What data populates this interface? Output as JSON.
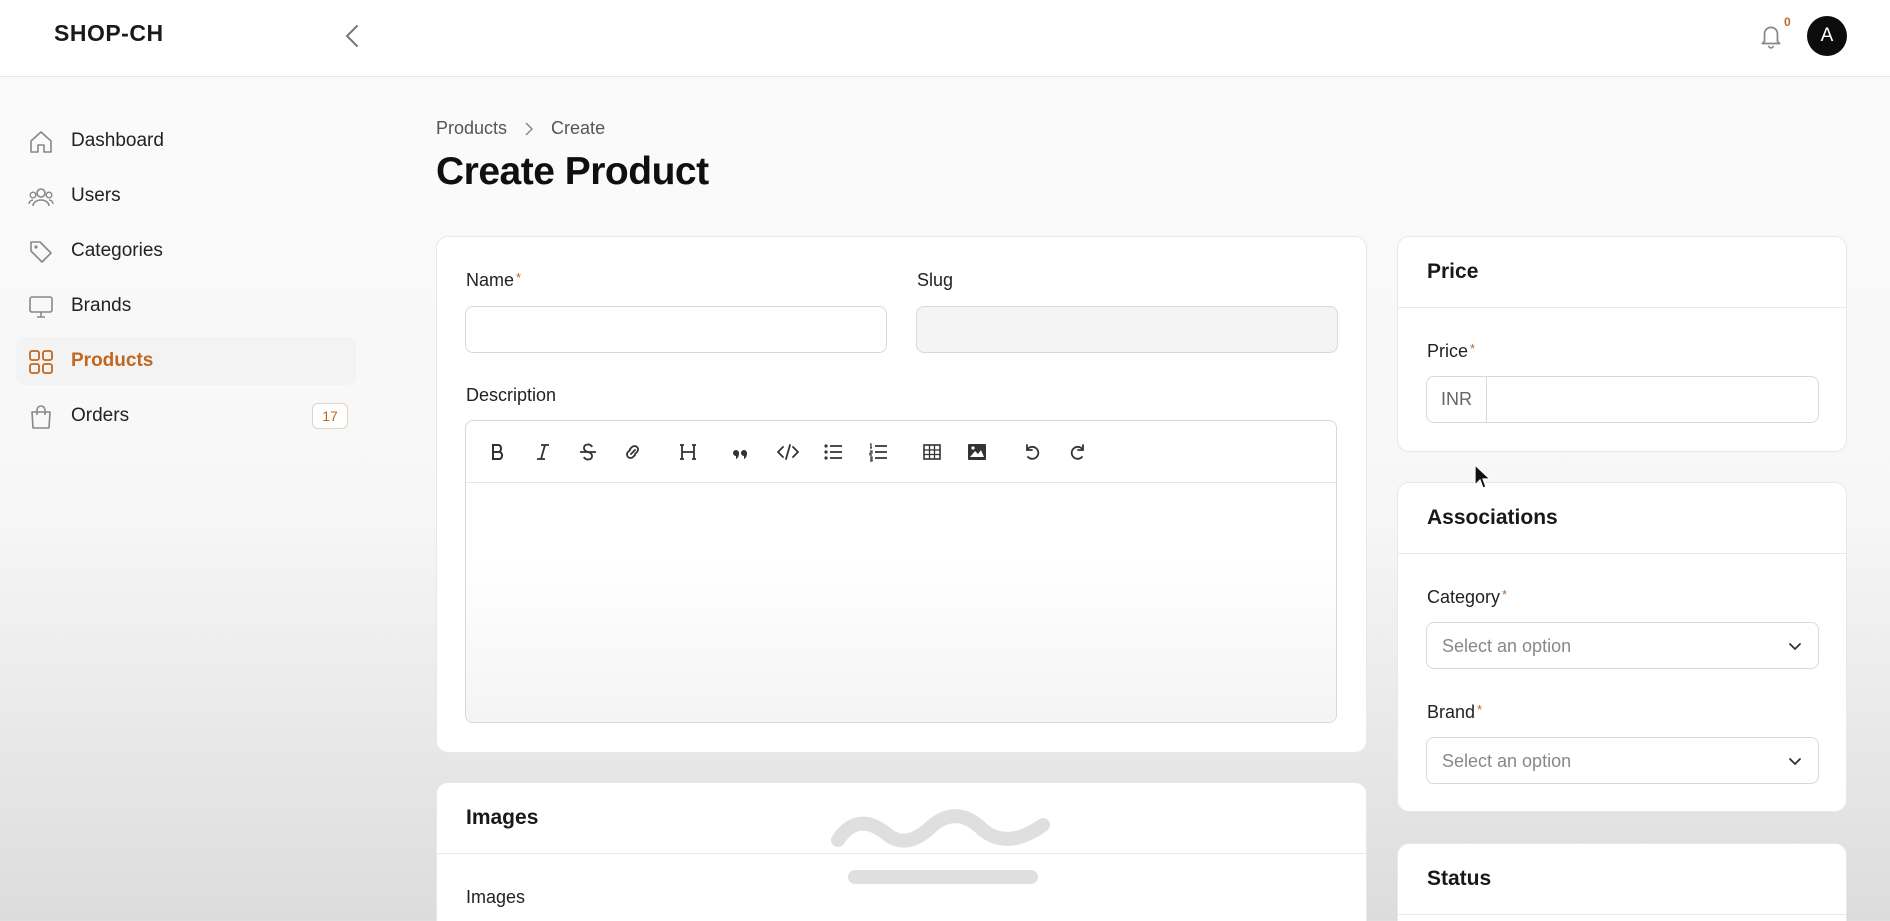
{
  "app": {
    "brand": "SHOP-CH"
  },
  "header": {
    "notifications_count": "0",
    "avatar_initial": "A"
  },
  "sidebar": {
    "items": [
      {
        "label": "Dashboard",
        "icon": "home-icon"
      },
      {
        "label": "Users",
        "icon": "users-icon"
      },
      {
        "label": "Categories",
        "icon": "tag-icon"
      },
      {
        "label": "Brands",
        "icon": "monitor-icon"
      },
      {
        "label": "Products",
        "icon": "grid-icon",
        "active": true
      },
      {
        "label": "Orders",
        "icon": "shopping-bag-icon",
        "badge": "17"
      }
    ]
  },
  "breadcrumb": {
    "parent": "Products",
    "current": "Create"
  },
  "page": {
    "title": "Create Product"
  },
  "form": {
    "name_label": "Name",
    "slug_label": "Slug",
    "description_label": "Description",
    "name_value": "",
    "slug_value": "",
    "toolbar": [
      "bold-icon",
      "italic-icon",
      "strikethrough-icon",
      "link-icon",
      "heading-icon",
      "blockquote-icon",
      "code-icon",
      "bullet-list-icon",
      "ordered-list-icon",
      "table-icon",
      "image-icon",
      "undo-icon",
      "redo-icon"
    ]
  },
  "images_card": {
    "title": "Images",
    "field_label": "Images"
  },
  "price_card": {
    "title": "Price",
    "price_label": "Price",
    "currency": "INR",
    "price_value": ""
  },
  "associations_card": {
    "title": "Associations",
    "category_label": "Category",
    "category_placeholder": "Select an option",
    "brand_label": "Brand",
    "brand_placeholder": "Select an option"
  },
  "status_card": {
    "title": "Status"
  },
  "colors": {
    "accent": "#c2671f"
  }
}
